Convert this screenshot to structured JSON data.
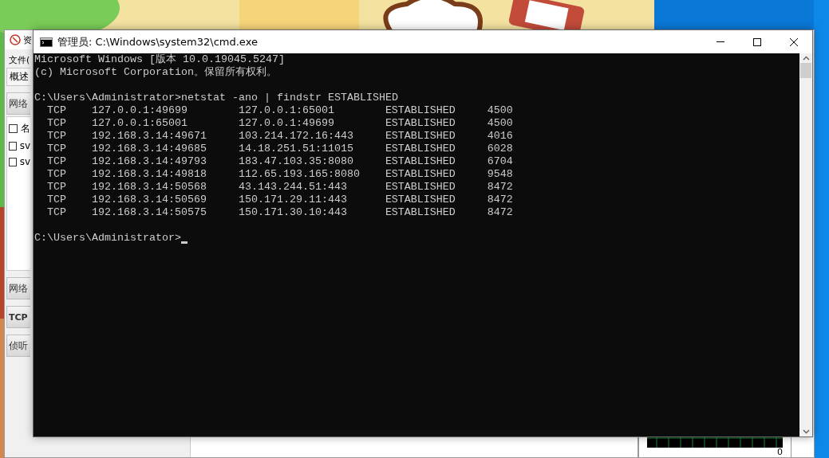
{
  "back_window": {
    "title": "资",
    "menu": [
      "文件("
    ],
    "tabs": [
      "概述"
    ],
    "sections": [
      {
        "kind": "list",
        "header": "网络",
        "rows": [
          {
            "label": "名",
            "checked": false
          },
          {
            "label": "sv",
            "checked": false
          },
          {
            "label": "sv",
            "checked": false
          }
        ]
      },
      {
        "kind": "header",
        "header": "网络"
      },
      {
        "kind": "header",
        "header": "TCP",
        "bold": true
      },
      {
        "kind": "header",
        "header": "侦听"
      }
    ],
    "graph_label": "0"
  },
  "cmd_window": {
    "title": "管理员: C:\\Windows\\system32\\cmd.exe",
    "lines": [
      "Microsoft Windows [版本 10.0.19045.5247]",
      "(c) Microsoft Corporation。保留所有权利。"
    ],
    "command": "C:\\Users\\Administrator>netstat -ano | findstr ESTABLISHED",
    "rows": [
      {
        "proto": "TCP",
        "local": "127.0.0.1:49699",
        "foreign": "127.0.0.1:65001",
        "state": "ESTABLISHED",
        "pid": "4500"
      },
      {
        "proto": "TCP",
        "local": "127.0.0.1:65001",
        "foreign": "127.0.0.1:49699",
        "state": "ESTABLISHED",
        "pid": "4500"
      },
      {
        "proto": "TCP",
        "local": "192.168.3.14:49671",
        "foreign": "103.214.172.16:443",
        "state": "ESTABLISHED",
        "pid": "4016"
      },
      {
        "proto": "TCP",
        "local": "192.168.3.14:49685",
        "foreign": "14.18.251.51:11015",
        "state": "ESTABLISHED",
        "pid": "6028"
      },
      {
        "proto": "TCP",
        "local": "192.168.3.14:49793",
        "foreign": "183.47.103.35:8080",
        "state": "ESTABLISHED",
        "pid": "6704"
      },
      {
        "proto": "TCP",
        "local": "192.168.3.14:49818",
        "foreign": "112.65.193.165:8080",
        "state": "ESTABLISHED",
        "pid": "9548"
      },
      {
        "proto": "TCP",
        "local": "192.168.3.14:50568",
        "foreign": "43.143.244.51:443",
        "state": "ESTABLISHED",
        "pid": "8472"
      },
      {
        "proto": "TCP",
        "local": "192.168.3.14:50569",
        "foreign": "150.171.29.11:443",
        "state": "ESTABLISHED",
        "pid": "8472"
      },
      {
        "proto": "TCP",
        "local": "192.168.3.14:50575",
        "foreign": "150.171.30.10:443",
        "state": "ESTABLISHED",
        "pid": "8472"
      }
    ],
    "prompt": "C:\\Users\\Administrator>"
  }
}
